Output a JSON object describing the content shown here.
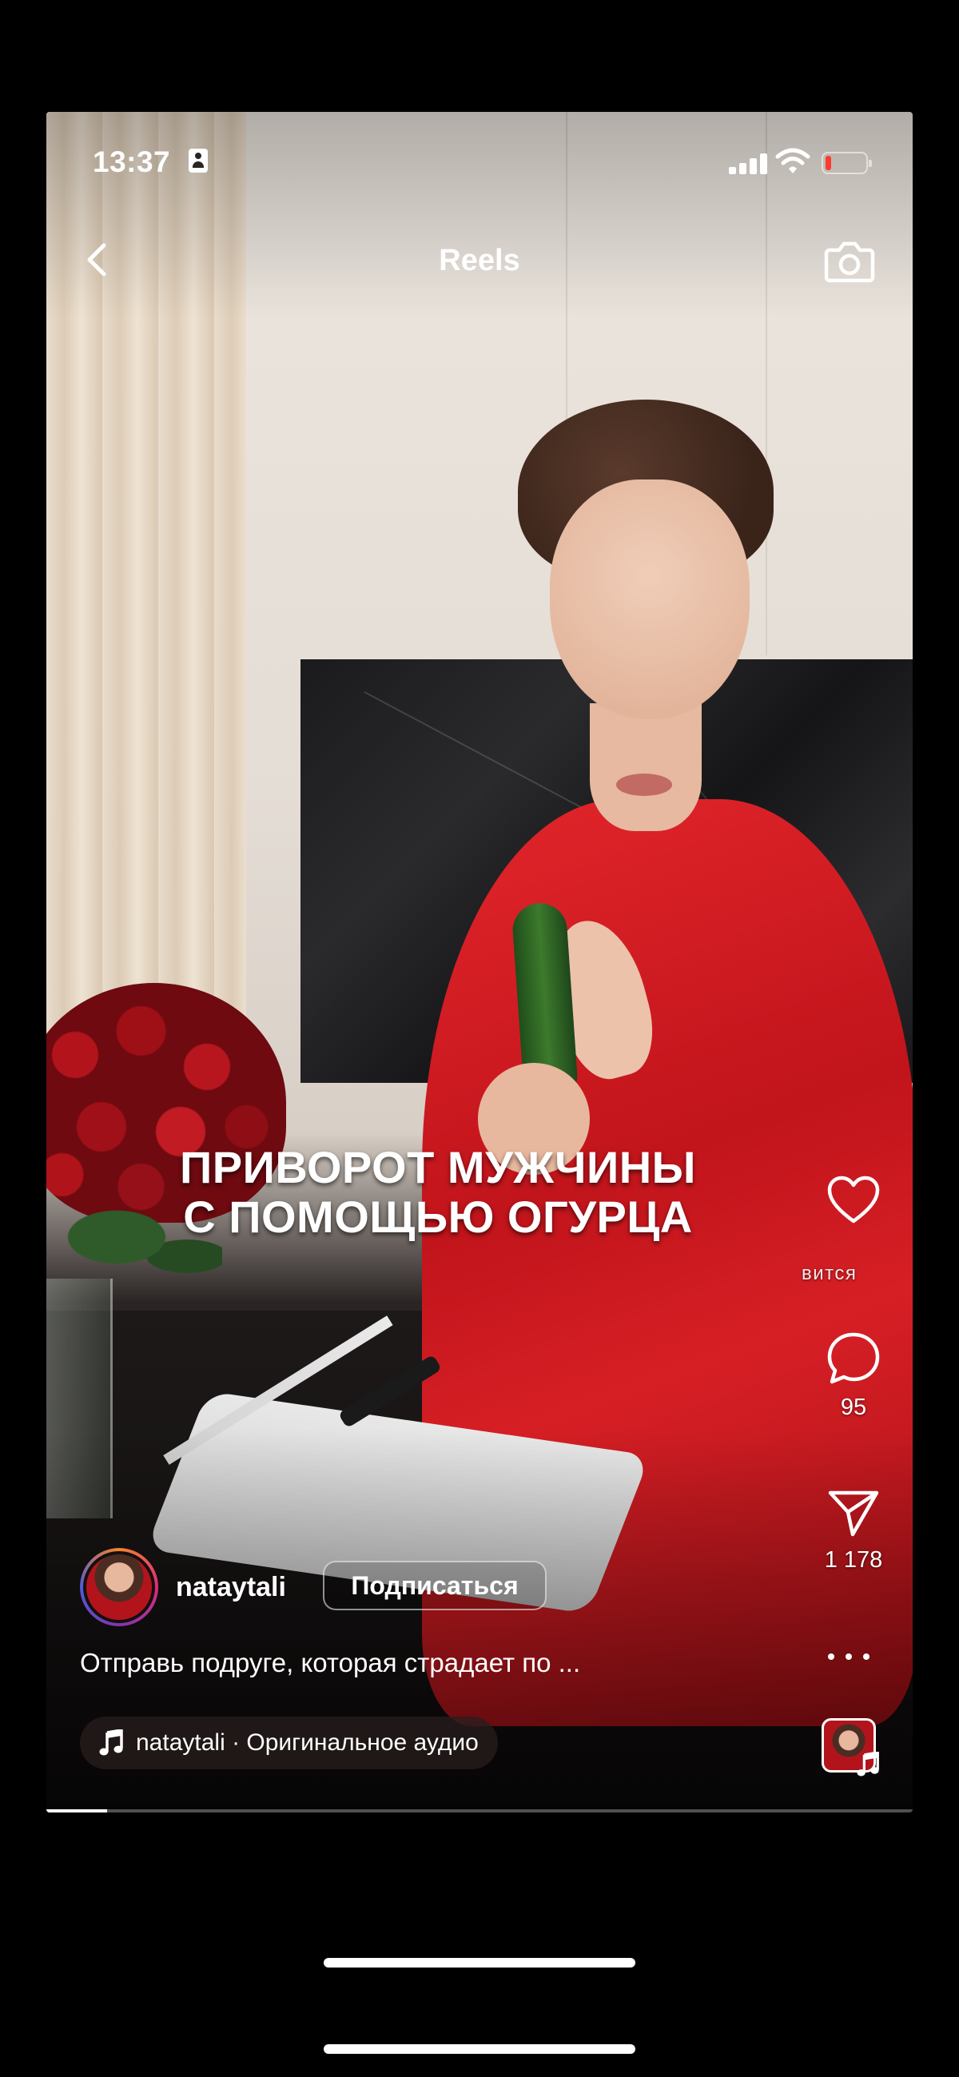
{
  "status_bar": {
    "time": "13:37"
  },
  "header": {
    "title": "Reels",
    "back_icon": "chevron-left-icon",
    "camera_icon": "camera-icon"
  },
  "video": {
    "caption_line1": "ПРИВОРОТ МУЖЧИНЫ",
    "caption_line2": "С ПОМОЩЬЮ ОГУРЦА",
    "progress": 0.07
  },
  "actions": {
    "like_icon": "heart-icon",
    "like_label": "вится",
    "comment_icon": "comment-icon",
    "comment_count": "95",
    "share_icon": "send-icon",
    "share_count": "1 178",
    "more_icon": "more-horizontal-icon"
  },
  "post": {
    "username": "nataytali",
    "follow_label": "Подписаться",
    "description": "Отправь подруге, которая страдает по ...",
    "audio_text": "nataytali · Оригинальное аудио"
  },
  "colors": {
    "accent_red": "#c1141b",
    "battery_low": "#ff3b30",
    "text": "#ffffff"
  }
}
